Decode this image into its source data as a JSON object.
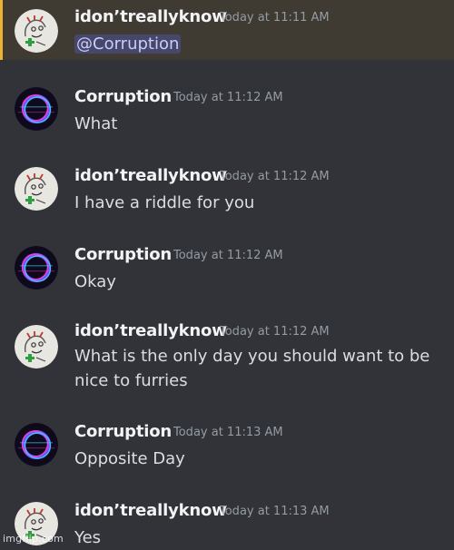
{
  "messages": [
    {
      "author": "idon’treallyknow",
      "timestamp": "Today at 11:11 AM",
      "mention": "@Corruption",
      "avatar": "sketch-avatar",
      "highlighted": true
    },
    {
      "author": "Corruption",
      "timestamp": "Today at 11:12 AM",
      "content": "What",
      "avatar": "neon-ring-avatar"
    },
    {
      "author": "idon’treallyknow",
      "timestamp": "Today at 11:12 AM",
      "content": "I have a riddle for you",
      "avatar": "sketch-avatar"
    },
    {
      "author": "Corruption",
      "timestamp": "Today at 11:12 AM",
      "content": "Okay",
      "avatar": "neon-ring-avatar"
    },
    {
      "author": "idon’treallyknow",
      "timestamp": "Today at 11:12 AM",
      "content_line1": "What is the only day you should want to be",
      "content_line2": "nice to furries",
      "avatar": "sketch-avatar"
    },
    {
      "author": "Corruption",
      "timestamp": "Today at 11:13 AM",
      "content": "Opposite Day",
      "avatar": "neon-ring-avatar"
    },
    {
      "author": "idon’treallyknow",
      "timestamp": "Today at 11:13 AM",
      "content": "Yes",
      "avatar": "sketch-avatar"
    }
  ],
  "watermark": "imgflip.com",
  "colors": {
    "background": "#313338",
    "highlight": "#3f3b33",
    "highlight_bar": "#f0b232",
    "username": "#f2f3f5",
    "timestamp": "#949ba4",
    "text": "#dbdee1",
    "mention_bg": "#5865f2"
  }
}
